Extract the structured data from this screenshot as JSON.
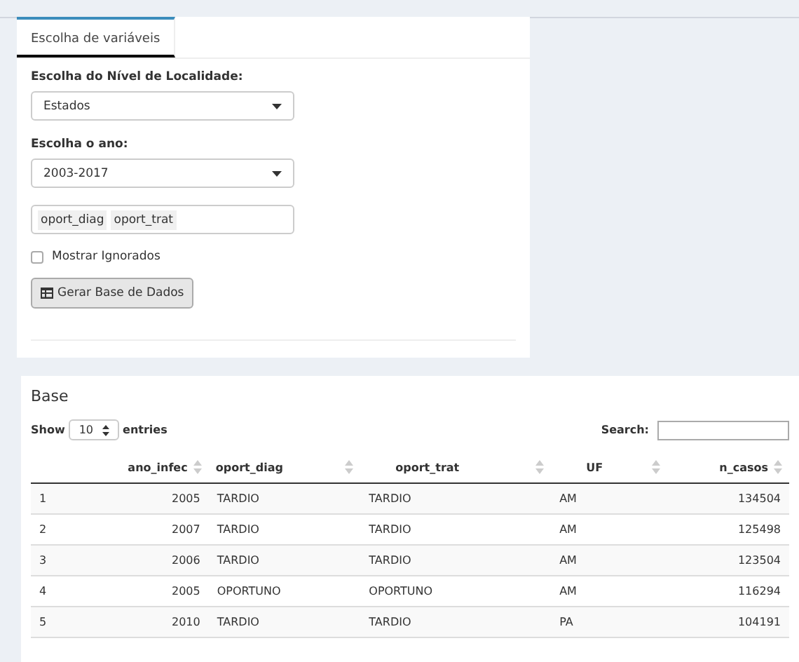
{
  "tabs": [
    {
      "label": "Escolha de variáveis",
      "selected": true
    }
  ],
  "form": {
    "locality_label": "Escolha do Nível de Localidade:",
    "locality_value": "Estados",
    "year_label": "Escolha o ano:",
    "year_value": "2003-2017",
    "variables": [
      "oport_diag",
      "oport_trat"
    ],
    "show_ignored": {
      "label": "Mostrar Ignorados",
      "checked": false
    },
    "generate_button": "Gerar Base de Dados"
  },
  "base": {
    "title": "Base",
    "show_label": "Show",
    "page_size": "10",
    "entries_label": "entries",
    "search_label": "Search:",
    "columns": [
      "",
      "ano_infec",
      "oport_diag",
      "oport_trat",
      "UF",
      "n_casos"
    ],
    "rows": [
      [
        "1",
        "2005",
        "TARDIO",
        "TARDIO",
        "AM",
        "134504"
      ],
      [
        "2",
        "2007",
        "TARDIO",
        "TARDIO",
        "AM",
        "125498"
      ],
      [
        "3",
        "2006",
        "TARDIO",
        "TARDIO",
        "AM",
        "123504"
      ],
      [
        "4",
        "2005",
        "OPORTUNO",
        "OPORTUNO",
        "AM",
        "116294"
      ],
      [
        "5",
        "2010",
        "TARDIO",
        "TARDIO",
        "PA",
        "104191"
      ]
    ]
  }
}
